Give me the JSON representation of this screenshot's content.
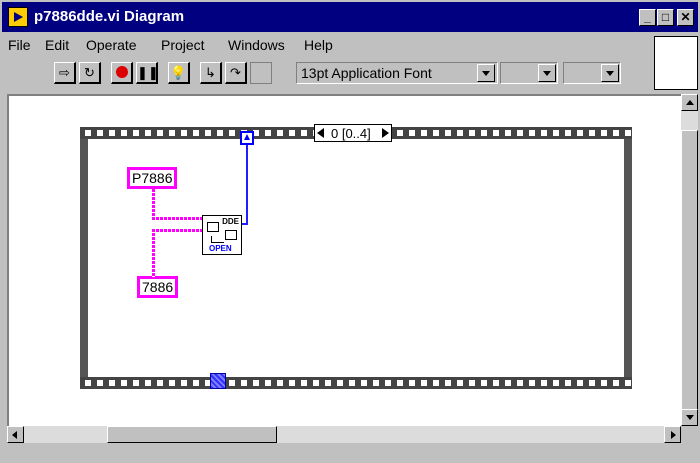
{
  "window": {
    "title": "p7886dde.vi Diagram",
    "controls": {
      "minimize": "_",
      "maximize": "□",
      "close": "✕"
    }
  },
  "menu": [
    "File",
    "Edit",
    "Operate",
    "Project",
    "Windows",
    "Help"
  ],
  "toolbar": {
    "buttons": [
      "run-arrow-icon",
      "run-continuous-icon",
      "abort-stop-icon",
      "pause-icon",
      "highlight-execution-icon",
      "step-into-icon",
      "step-over-icon",
      "step-out-icon"
    ],
    "font": "13pt Application Font"
  },
  "diagram": {
    "sequence_frame": "0 [0..4]",
    "constants": {
      "service": "P7886",
      "topic": "7886"
    },
    "subvi": {
      "top_label": "DDE",
      "bottom_label": "OPEN"
    }
  },
  "colors": {
    "title_bar": "#000080",
    "string_wire": "#ff00ff",
    "refnum_wire": "#2020ff",
    "window_bg": "#c0c0c0"
  }
}
